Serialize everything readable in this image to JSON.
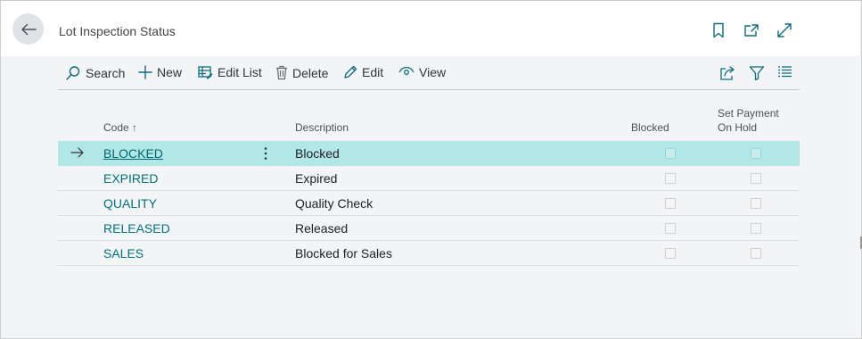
{
  "header": {
    "title": "Lot Inspection Status",
    "icons": [
      "arrow-left-icon",
      "bookmark-icon",
      "open-new-window-icon",
      "expand-icon"
    ]
  },
  "toolbar": {
    "search": "Search",
    "new": "New",
    "edit_list": "Edit List",
    "delete": "Delete",
    "edit": "Edit",
    "view": "View",
    "right_icons": [
      "share-icon",
      "filter-icon",
      "list-view-icon"
    ]
  },
  "table": {
    "columns": {
      "code": "Code",
      "sort_indicator": "↑",
      "description": "Description",
      "blocked": "Blocked",
      "set_payment_on_hold_line1": "Set Payment",
      "set_payment_on_hold_line2": "On Hold"
    },
    "rows": [
      {
        "code": "BLOCKED",
        "description": "Blocked",
        "blocked": false,
        "set_payment_on_hold": false,
        "selected": true
      },
      {
        "code": "EXPIRED",
        "description": "Expired",
        "blocked": false,
        "set_payment_on_hold": false
      },
      {
        "code": "QUALITY",
        "description": "Quality Check",
        "blocked": false,
        "set_payment_on_hold": false
      },
      {
        "code": "RELEASED",
        "description": "Released",
        "blocked": false,
        "set_payment_on_hold": false
      },
      {
        "code": "SALES",
        "description": "Blocked for Sales",
        "blocked": false,
        "set_payment_on_hold": false
      }
    ]
  },
  "colors": {
    "selected_row": "#b2e7e8",
    "link": "#00727a",
    "accent_icon": "#0f6b78"
  }
}
